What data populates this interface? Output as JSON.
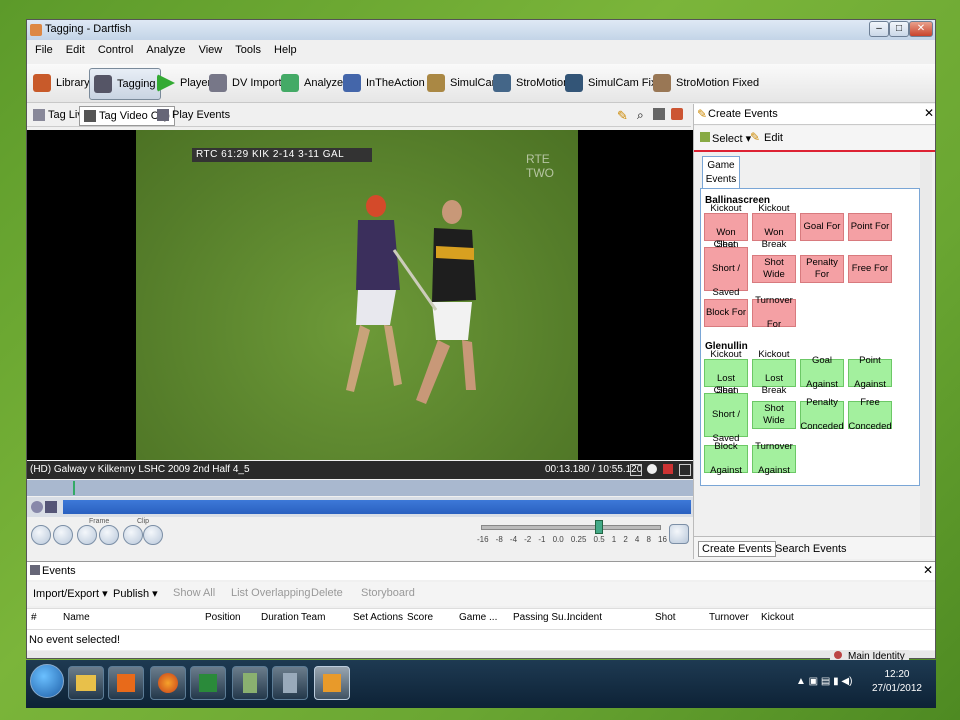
{
  "window": {
    "title": "Tagging - Dartfish"
  },
  "menu": [
    "File",
    "Edit",
    "Control",
    "Analyze",
    "View",
    "Tools",
    "Help"
  ],
  "toolbar": {
    "items": [
      {
        "label": "Library",
        "selected": false
      },
      {
        "label": "Tagging",
        "selected": true
      },
      {
        "label": "Player",
        "selected": false
      },
      {
        "label": "DV Import",
        "selected": false
      },
      {
        "label": "Analyzer",
        "selected": false
      },
      {
        "label": "InTheAction",
        "selected": false
      },
      {
        "label": "SimulCam",
        "selected": false
      },
      {
        "label": "StroMotion",
        "selected": false
      },
      {
        "label": "SimulCam Fixed",
        "selected": false
      },
      {
        "label": "StroMotion Fixed",
        "selected": false
      }
    ]
  },
  "subtabs": [
    {
      "label": "Tag Live",
      "selected": false
    },
    {
      "label": "Tag Video Clip",
      "selected": true
    },
    {
      "label": "Play Events",
      "selected": false
    }
  ],
  "video": {
    "scorebug": "RTC 61:29 KIK 2-14 3-11 GAL",
    "channel": "RTE TWO",
    "clip_name": "(HD) Galway v Kilkenny LSHC 2009 2nd Half 4_5",
    "timecode": "00:13.180 / 10:55.120"
  },
  "playback": {
    "frame_label": "Frame",
    "clip_label": "Clip",
    "speeds": [
      "-16",
      "-8",
      "-4",
      "-2",
      "-1",
      "0.0",
      "0.25",
      "0.5",
      "1",
      "2",
      "4",
      "8",
      "16"
    ]
  },
  "right_panel": {
    "title": "Create Events",
    "select_label": "Select",
    "edit_label": "Edit",
    "tab_label_1": "Game",
    "tab_label_2": "Events",
    "group1": {
      "name": "Ballinascreen",
      "buttons": [
        [
          "Kickout",
          "Won Clean"
        ],
        [
          "Kickout",
          "Won Break"
        ],
        [
          "Goal For"
        ],
        [
          "Point For"
        ],
        [
          "Shot",
          "Short /",
          "Saved"
        ],
        [
          "Shot Wide"
        ],
        [
          "Penalty For"
        ],
        [
          "Free For"
        ],
        [
          "Block For"
        ],
        [
          "Turnover",
          "For"
        ]
      ]
    },
    "group2": {
      "name": "Glenullin",
      "buttons": [
        [
          "Kickout",
          "Lost Clean"
        ],
        [
          "Kickout",
          "Lost Break"
        ],
        [
          "Goal",
          "Against"
        ],
        [
          "Point",
          "Against"
        ],
        [
          "Shot",
          "Short /",
          "Saved"
        ],
        [
          "Shot Wide"
        ],
        [
          "Penalty",
          "Conceded"
        ],
        [
          "Free",
          "Conceded"
        ],
        [
          "Block",
          "Against"
        ],
        [
          "Turnover",
          "Against"
        ]
      ]
    },
    "bottom_tabs": [
      "Create Events",
      "Search Events"
    ]
  },
  "events": {
    "title": "Events",
    "toolbar": [
      "Import/Export",
      "Publish",
      "Show All",
      "List Overlapping",
      "Delete",
      "Storyboard"
    ],
    "columns": [
      "#",
      "Name",
      "Position",
      "Duration",
      "Team",
      "Set Actions",
      "Score",
      "Game ...",
      "Passing Su...",
      "Incident",
      "Shot",
      "Turnover",
      "Kickout"
    ],
    "empty_message": "No event selected!",
    "identity": "Main Identity"
  },
  "taskbar": {
    "time": "12:20",
    "date": "27/01/2012"
  },
  "colors": {
    "red_button": "#f4a0a4",
    "green_button": "#a3f09e",
    "timeline_blue": "#2a60c0",
    "accent_red": "#dd2233"
  }
}
